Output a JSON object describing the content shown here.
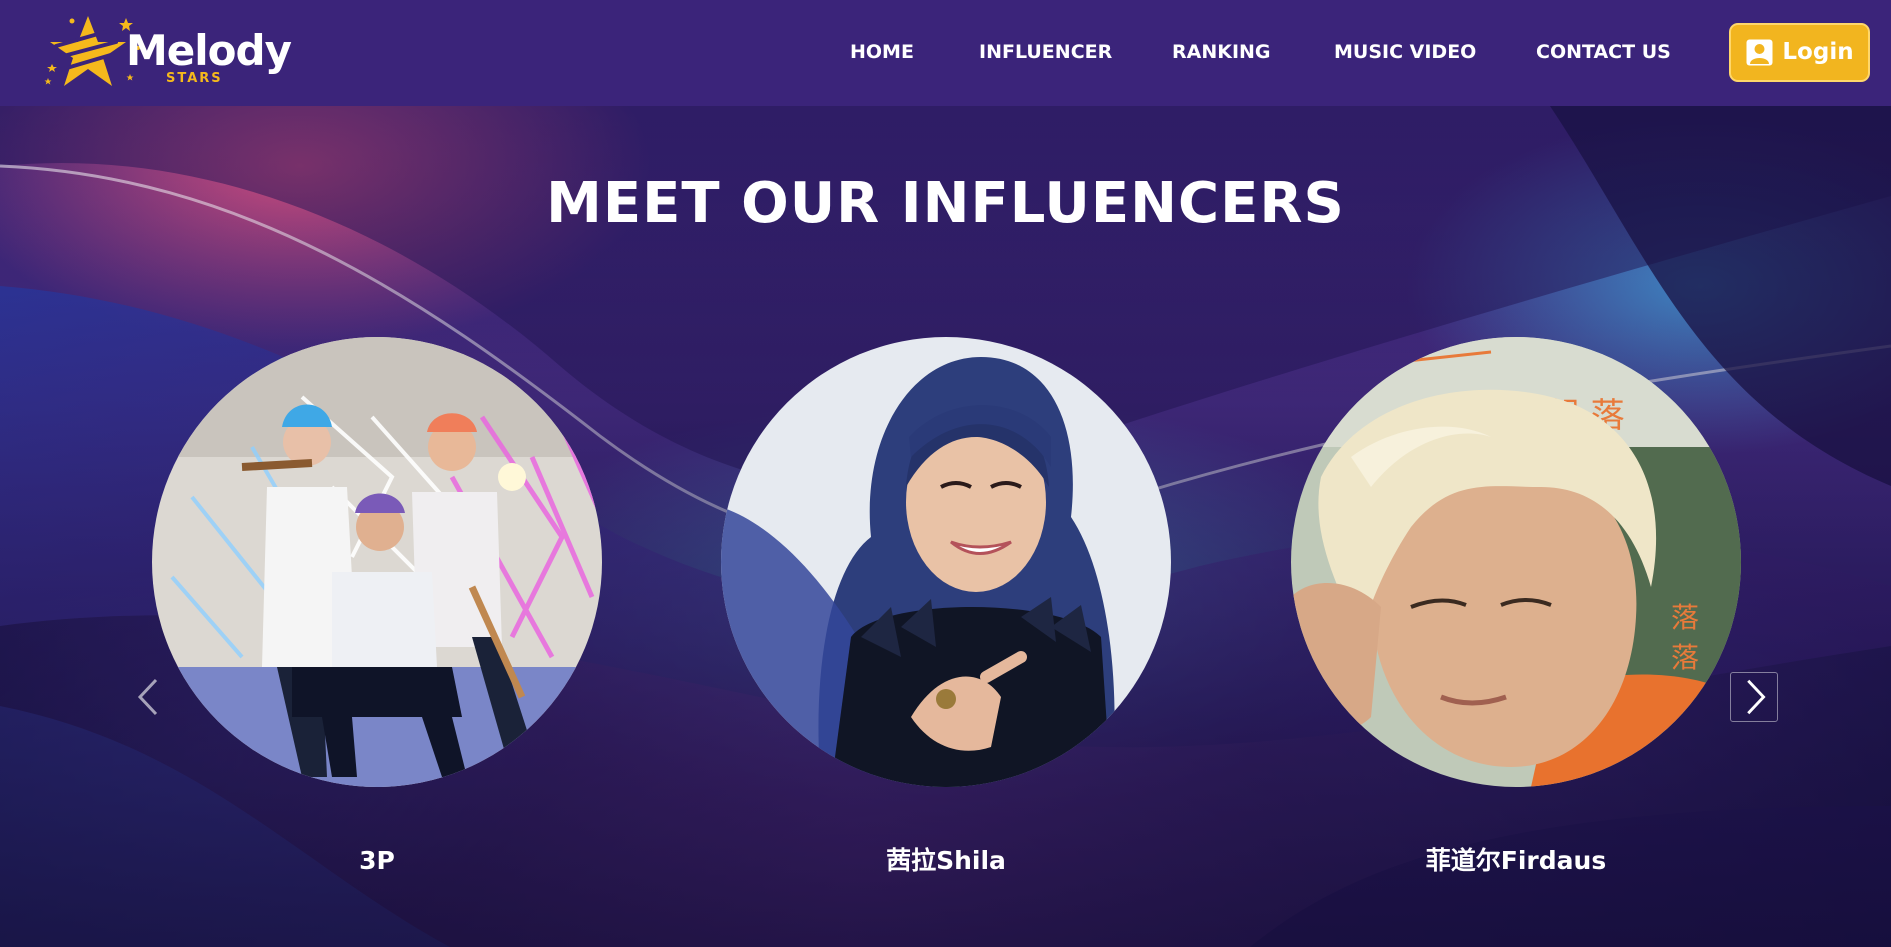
{
  "brand": {
    "name": "Melody",
    "tagline": "STARS",
    "colors": {
      "primary": "#3b247a",
      "accent": "#f2b51f"
    }
  },
  "nav": {
    "items": [
      {
        "label": "HOME"
      },
      {
        "label": "INFLUENCER"
      },
      {
        "label": "RANKING"
      },
      {
        "label": "MUSIC VIDEO"
      },
      {
        "label": "CONTACT US"
      }
    ]
  },
  "login": {
    "label": "Login",
    "icon": "user-icon"
  },
  "hero": {
    "title": "MEET OUR INFLUENCERS",
    "influencers": [
      {
        "name": "3P"
      },
      {
        "name": "茜拉Shila"
      },
      {
        "name": "菲道尔Firdaus"
      }
    ],
    "prev_icon": "chevron-left-icon",
    "next_icon": "chevron-right-icon"
  }
}
